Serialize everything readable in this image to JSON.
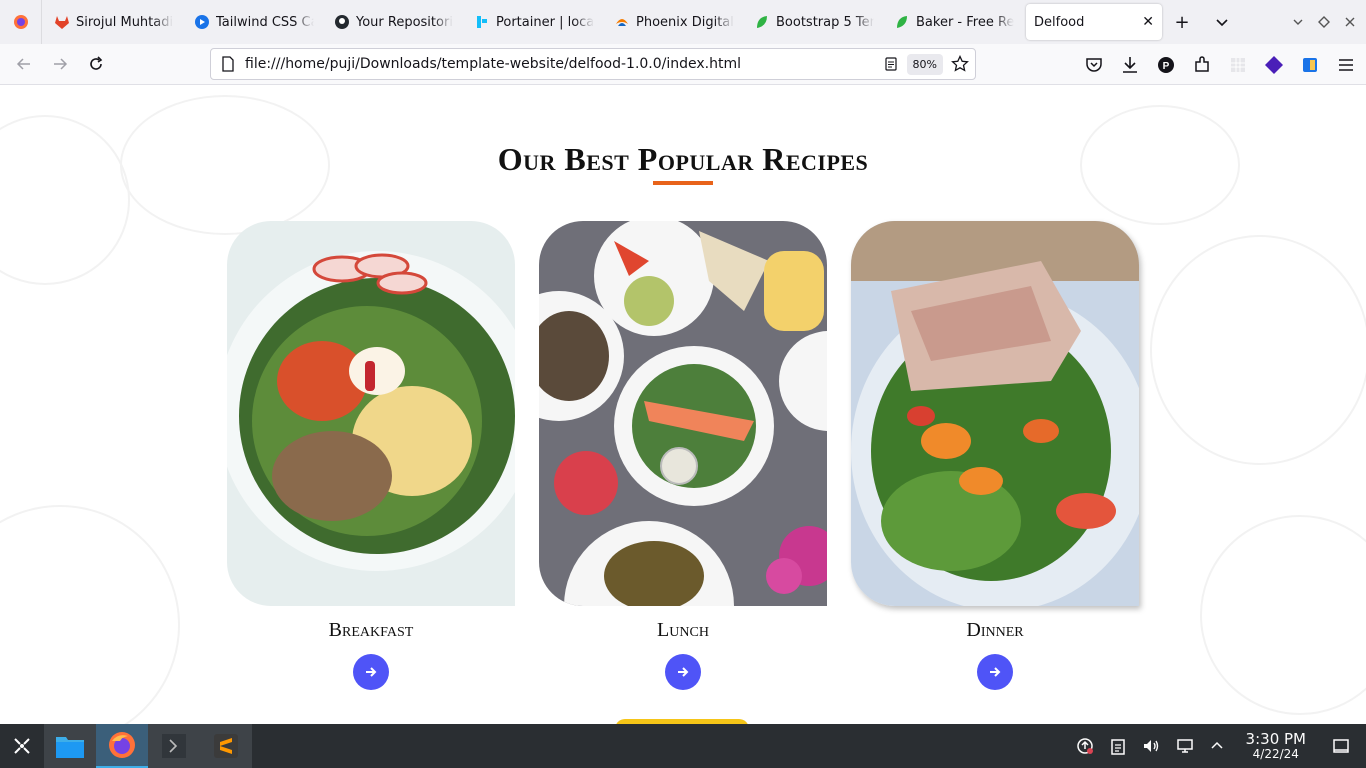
{
  "browser": {
    "tabs": [
      {
        "title": "Sirojul Muhtadi",
        "icon": "gitlab-icon",
        "color": "#e24329"
      },
      {
        "title": "Tailwind CSS Ca",
        "icon": "play-circle-icon",
        "color": "#1a73e8"
      },
      {
        "title": "Your Repositori",
        "icon": "github-icon",
        "color": "#24292f"
      },
      {
        "title": "Portainer | loca",
        "icon": "portainer-icon",
        "color": "#13bef9"
      },
      {
        "title": "Phoenix Digital",
        "icon": "phoenix-icon",
        "color": "#f57c00"
      },
      {
        "title": "Bootstrap 5 Ten",
        "icon": "leaf-icon",
        "color": "#2fb344"
      },
      {
        "title": "Baker - Free Re",
        "icon": "leaf-icon",
        "color": "#2fb344"
      }
    ],
    "active_tab": {
      "title": "Delfood",
      "close": "✕"
    },
    "new_tab": "+",
    "url": "file:///home/puji/Downloads/template-website/delfood-1.0.0/index.html",
    "zoom": "80%"
  },
  "page": {
    "section_title": "Our Best Popular Recipes",
    "accent_color": "#e8631a",
    "button_color": "#4f54f7",
    "cards": [
      {
        "name": "Breakfast"
      },
      {
        "name": "Lunch"
      },
      {
        "name": "Dinner"
      }
    ]
  },
  "taskbar": {
    "time": "3:30 PM",
    "date": "4/22/24"
  }
}
